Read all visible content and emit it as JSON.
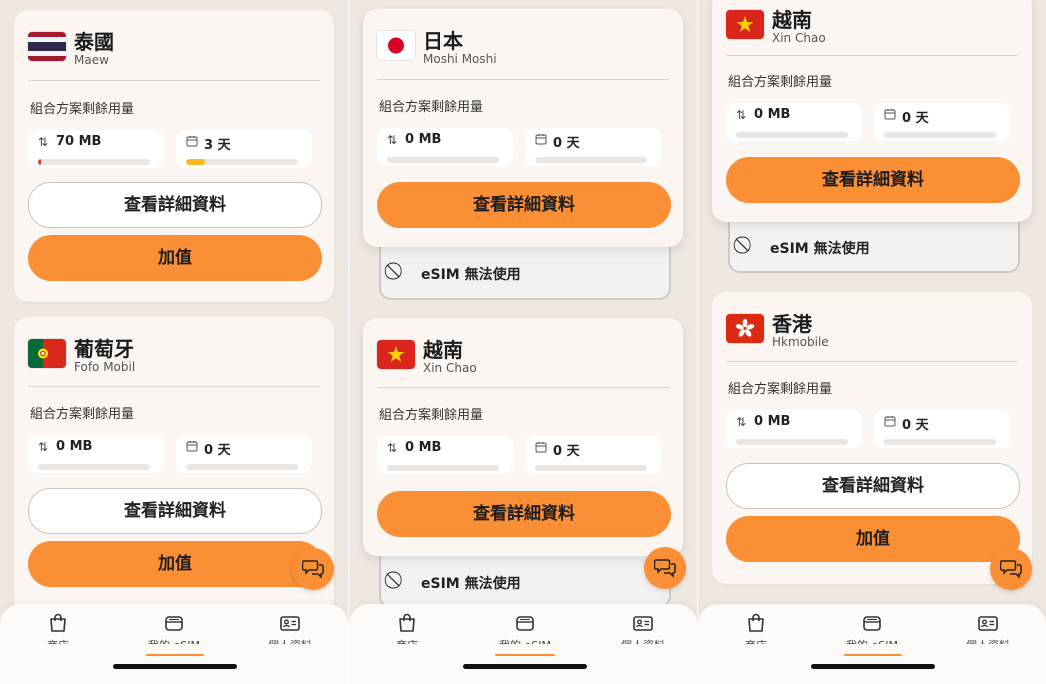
{
  "labels": {
    "usage": "組合方案剩餘用量",
    "details_button": "查看詳細資料",
    "topup_button": "加值",
    "esim_unavailable": "eSIM 無法使用"
  },
  "colors": {
    "accent": "#fb8f36",
    "background": "#efe8e1",
    "card": "#fbf6f2",
    "usage_bar": "#e53935"
  },
  "nav": [
    {
      "label": "商店",
      "icon": "shopping-bag-icon"
    },
    {
      "label": "我的 eSIM",
      "icon": "sim-card-icon",
      "active": true
    },
    {
      "label": "個人資料",
      "icon": "id-card-icon"
    }
  ],
  "screens": [
    {
      "cards": [
        {
          "country": "泰國",
          "network": "Maew",
          "data": "70 MB",
          "days": "3 天",
          "data_progress": 0.02,
          "days_progress": 0.17,
          "flag": "thailand-flag"
        },
        {
          "country": "葡萄牙",
          "network": "Fofo Mobil",
          "data": "0 MB",
          "days": "0 天",
          "data_progress": 0,
          "days_progress": 0,
          "flag": "portugal-flag"
        }
      ]
    },
    {
      "cards": [
        {
          "country": "日本",
          "network": "Moshi Moshi",
          "data": "0 MB",
          "days": "0 天",
          "data_progress": 0,
          "days_progress": 0,
          "flag": "japan-flag"
        },
        {
          "country": "越南",
          "network": "Xin Chao",
          "data": "0 MB",
          "days": "0 天",
          "data_progress": 0,
          "days_progress": 0,
          "flag": "vietnam-flag"
        }
      ]
    },
    {
      "cards": [
        {
          "country": "越南",
          "network": "Xin Chao",
          "data": "0 MB",
          "days": "0 天",
          "data_progress": 0,
          "days_progress": 0,
          "flag": "vietnam-flag"
        },
        {
          "country": "香港",
          "network": "Hkmobile",
          "data": "0 MB",
          "days": "0 天",
          "data_progress": 0,
          "days_progress": 0,
          "flag": "hong-kong-flag"
        }
      ]
    }
  ]
}
